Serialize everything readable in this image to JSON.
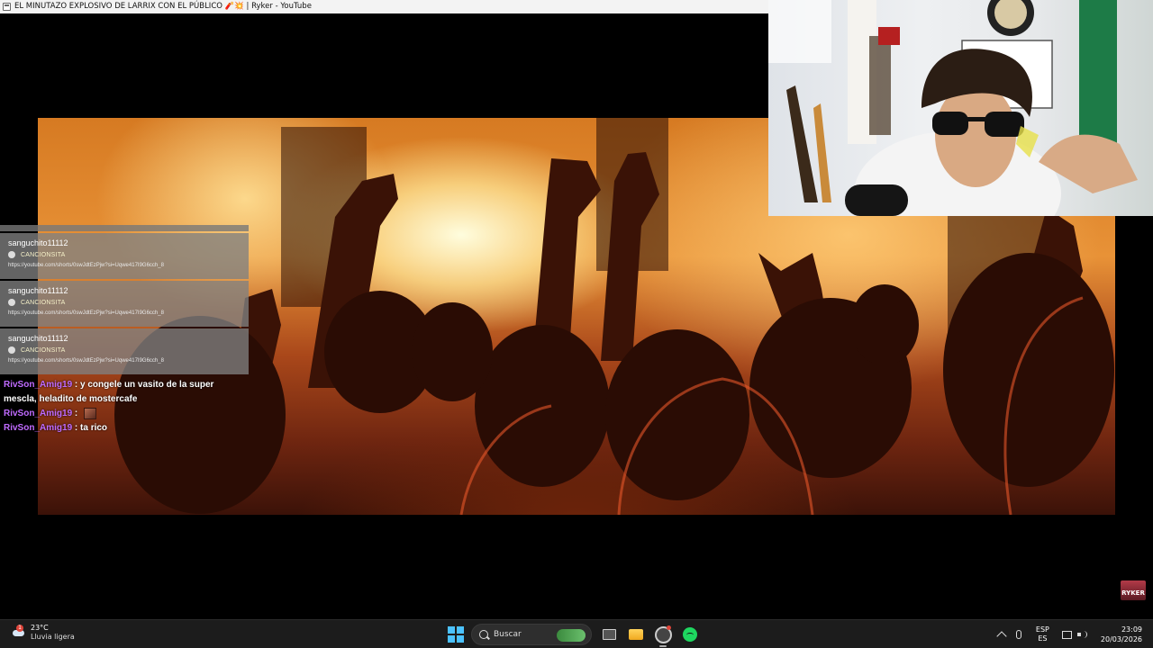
{
  "window": {
    "title": "EL MINUTAZO EXPLOSIVO DE LARRIX CON EL PÚBLICO 🧨💥 | Ryker - YouTube"
  },
  "chat": {
    "song_requests": [
      {
        "author": "sanguchito11112",
        "song": "CANCIONSITA",
        "link": "https://youtube.com/shorts/0swJdtEzPjw?si=Uqwe417I9G6cch_8"
      },
      {
        "author": "sanguchito11112",
        "song": "CANCIONSITA",
        "link": "https://youtube.com/shorts/0swJdtEzPjw?si=Uqwe417I9G6cch_8"
      },
      {
        "author": "sanguchito11112",
        "song": "CANCIONSITA",
        "link": "https://youtube.com/shorts/0swJdtEzPjw?si=Uqwe417I9G6cch_8"
      }
    ],
    "messages": [
      {
        "user": "RivSon_Amig19",
        "sep": " : ",
        "text": "y congele un vasito de la super mescla, heladito de mostercafe"
      },
      {
        "user": "RivSon_Amig19",
        "sep": " : ",
        "text": ""
      },
      {
        "user": "RivSon_Amig19",
        "sep": " : ",
        "text": "ta rico"
      }
    ],
    "user_color": "#c06bff"
  },
  "overlay": {
    "logo_text": "RYKER"
  },
  "taskbar": {
    "weather_temp": "23°C",
    "weather_desc": "Lluvia ligera",
    "weather_badge": "1",
    "search_label": "Buscar",
    "lang_top": "ESP",
    "lang_bottom": "ES",
    "time": "23:09",
    "date": "20/03/2026",
    "accent_color": "#4cc2ff",
    "spotify_color": "#1ed760"
  }
}
